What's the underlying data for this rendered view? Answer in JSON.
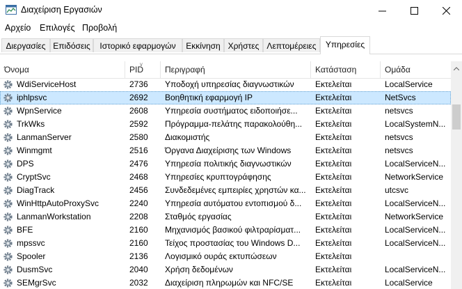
{
  "window": {
    "title": "Διαχείριση Εργασιών"
  },
  "menu": [
    "Αρχείο",
    "Επιλογές",
    "Προβολή"
  ],
  "tabs": [
    {
      "label": "Διεργασίες"
    },
    {
      "label": "Επιδόσεις"
    },
    {
      "label": "Ιστορικό εφαρμογών"
    },
    {
      "label": "Εκκίνηση"
    },
    {
      "label": "Χρήστες"
    },
    {
      "label": "Λεπτομέρειες"
    },
    {
      "label": "Υπηρεσίες"
    }
  ],
  "active_tab": "Υπηρεσίες",
  "columns": [
    "Όνομα",
    "PID",
    "Περιγραφή",
    "Κατάσταση",
    "Ομάδα"
  ],
  "rows": [
    {
      "name": "WdiServiceHost",
      "pid": "2736",
      "desc": "Υποδοχή υπηρεσίας διαγνωστικών",
      "status": "Εκτελείται",
      "group": "LocalService"
    },
    {
      "name": "iphlpsvc",
      "pid": "2692",
      "desc": "Βοηθητική εφαρμογή IP",
      "status": "Εκτελείται",
      "group": "NetSvcs"
    },
    {
      "name": "WpnService",
      "pid": "2608",
      "desc": "Υπηρεσία συστήματος ειδοποιήσε...",
      "status": "Εκτελείται",
      "group": "netsvcs"
    },
    {
      "name": "TrkWks",
      "pid": "2592",
      "desc": "Πρόγραμμα-πελάτης παρακολούθη...",
      "status": "Εκτελείται",
      "group": "LocalSystemN..."
    },
    {
      "name": "LanmanServer",
      "pid": "2580",
      "desc": "Διακομιστής",
      "status": "Εκτελείται",
      "group": "netsvcs"
    },
    {
      "name": "Winmgmt",
      "pid": "2516",
      "desc": "Όργανα Διαχείρισης των Windows",
      "status": "Εκτελείται",
      "group": "netsvcs"
    },
    {
      "name": "DPS",
      "pid": "2476",
      "desc": "Υπηρεσία πολιτικής διαγνωστικών",
      "status": "Εκτελείται",
      "group": "LocalServiceN..."
    },
    {
      "name": "CryptSvc",
      "pid": "2468",
      "desc": "Υπηρεσίες κρυπτογράφησης",
      "status": "Εκτελείται",
      "group": "NetworkService"
    },
    {
      "name": "DiagTrack",
      "pid": "2456",
      "desc": "Συνδεδεμένες εμπειρίες χρηστών κα...",
      "status": "Εκτελείται",
      "group": "utcsvc"
    },
    {
      "name": "WinHttpAutoProxySvc",
      "pid": "2240",
      "desc": "Υπηρεσία αυτόματου εντοπισμού δ...",
      "status": "Εκτελείται",
      "group": "LocalServiceN..."
    },
    {
      "name": "LanmanWorkstation",
      "pid": "2208",
      "desc": "Σταθμός εργασίας",
      "status": "Εκτελείται",
      "group": "NetworkService"
    },
    {
      "name": "BFE",
      "pid": "2160",
      "desc": "Μηχανισμός βασικού φιλτραρίσματ...",
      "status": "Εκτελείται",
      "group": "LocalServiceN..."
    },
    {
      "name": "mpssvc",
      "pid": "2160",
      "desc": "Τείχος προστασίας του Windows D...",
      "status": "Εκτελείται",
      "group": "LocalServiceN..."
    },
    {
      "name": "Spooler",
      "pid": "2136",
      "desc": "Λογισμικό ουράς εκτυπώσεων",
      "status": "Εκτελείται",
      "group": ""
    },
    {
      "name": "DusmSvc",
      "pid": "2040",
      "desc": "Χρήση δεδομένων",
      "status": "Εκτελείται",
      "group": "LocalServiceN..."
    },
    {
      "name": "SEMgrSvc",
      "pid": "2032",
      "desc": "Διαχείριση πληρωμών και NFC/SE",
      "status": "Εκτελείται",
      "group": "LocalService"
    }
  ],
  "selected_row": "iphlpsvc",
  "icons": {
    "app": "task-manager-icon",
    "row": "gear-icon"
  }
}
